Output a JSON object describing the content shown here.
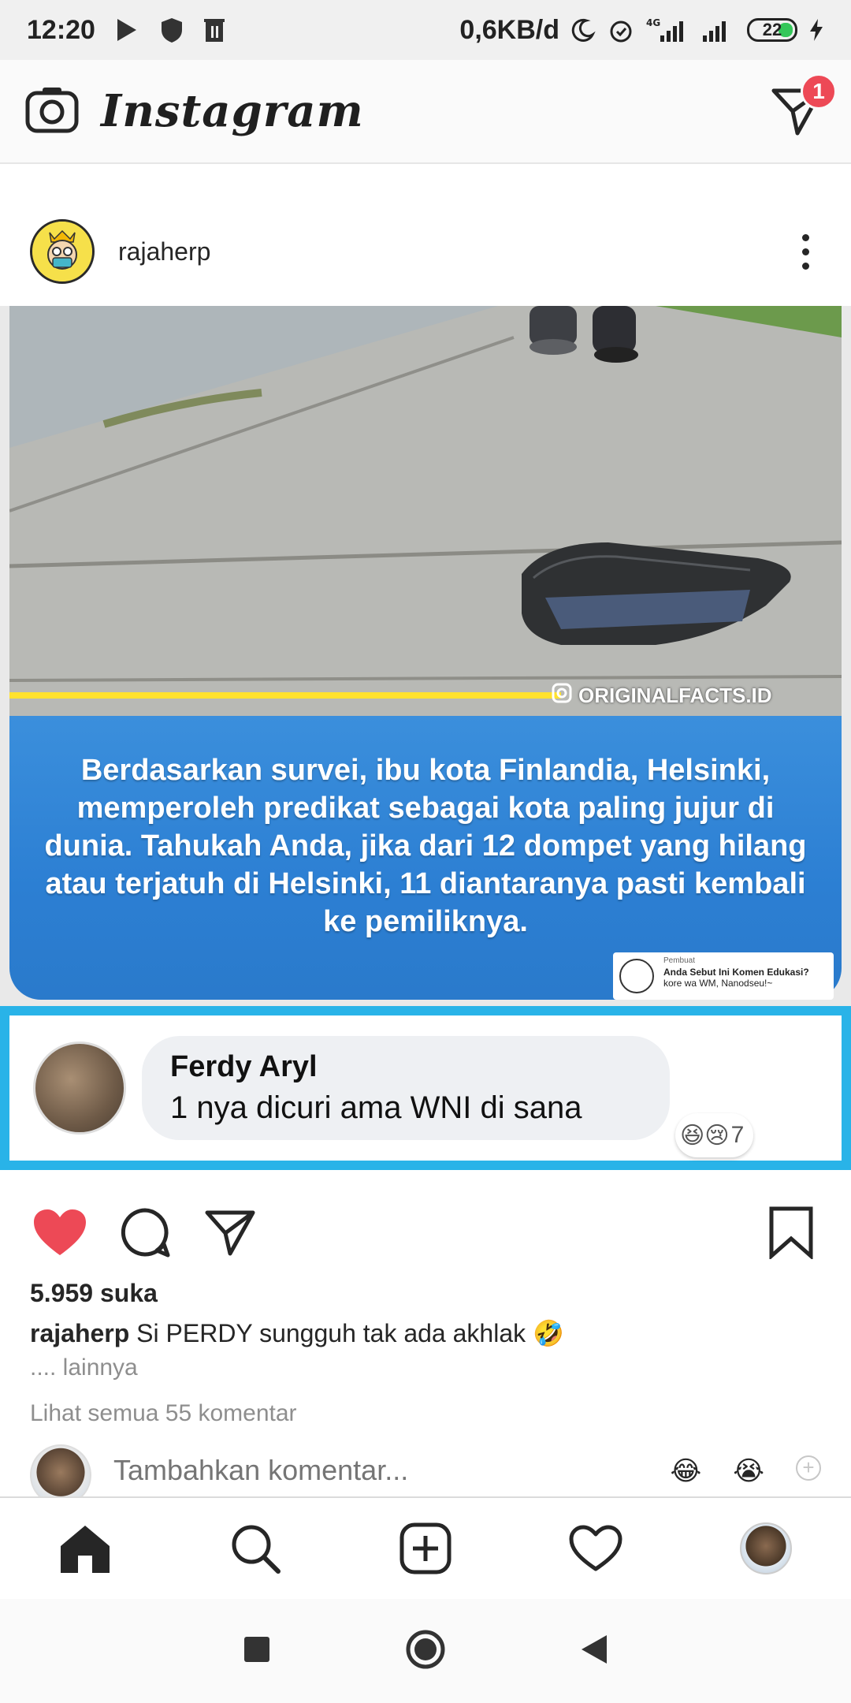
{
  "status_bar": {
    "time": "12:20",
    "data_speed": "0,6KB/d",
    "network": "4G",
    "battery": "22"
  },
  "header": {
    "app_title": "Instagram",
    "dm_badge_count": "1"
  },
  "post": {
    "username": "rajaherp",
    "image": {
      "watermark": "ORIGINALFACTS.ID",
      "fact_text": "Berdasarkan survei, ibu kota Finlandia, Helsinki, memperoleh predikat sebagai kota paling jujur di dunia. Tahukah Anda, jika dari 12 dompet yang hilang atau terjatuh di Helsinki, 11 diantaranya pasti kembali ke pemiliknya.",
      "credit": {
        "label": "Pembuat",
        "title": "Anda Sebut Ini Komen Edukasi?",
        "subtitle": "kore wa WM, Nanodseu!~"
      },
      "comment": {
        "name": "Ferdy Aryl",
        "text": "1 nya dicuri ama WNI di sana",
        "reactions": "😆😢",
        "reaction_count": "7"
      }
    },
    "likes": "5.959 suka",
    "caption_user": "rajaherp",
    "caption_text": "Si PERDY sungguh tak ada akhlak 🤣",
    "more_label": ".... lainnya",
    "view_comments": "Lihat semua 55 komentar",
    "add_comment_placeholder": "Tambahkan komentar...",
    "quick_emojis": [
      "😂",
      "😭"
    ]
  },
  "colors": {
    "like_red": "#ed4956",
    "panel_blue": "#2c7fd3",
    "frame_cyan": "#29b3e8"
  }
}
